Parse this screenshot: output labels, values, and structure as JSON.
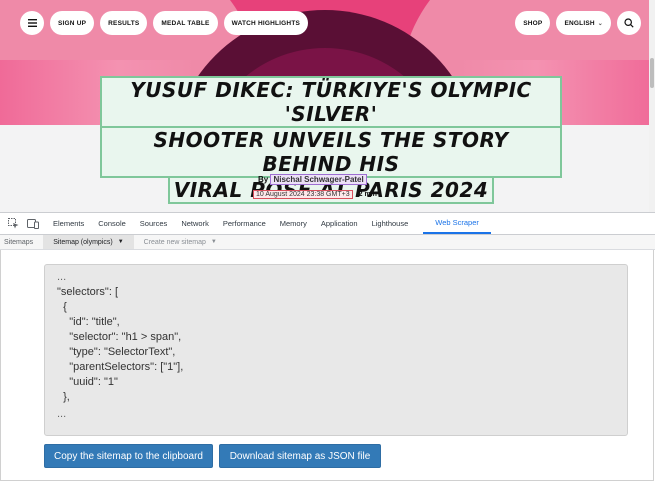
{
  "site": {
    "nav_left": [
      "SIGN UP",
      "RESULTS",
      "MEDAL TABLE",
      "WATCH HIGHLIGHTS"
    ],
    "nav_right_shop": "SHOP",
    "nav_right_lang": "ENGLISH",
    "headline_lines": [
      "YUSUF DIKEC: TÜRKIYE'S OLYMPIC 'SILVER'",
      "SHOOTER UNVEILS THE STORY BEHIND HIS",
      "VIRAL POSE AT PARIS 2024"
    ],
    "byline_prefix": "By",
    "author": "Nischal Schwager-Patel",
    "date": "10 August 2024 23:38 GMT+3",
    "read_time": "2 min"
  },
  "devtools": {
    "tabs": [
      "Elements",
      "Console",
      "Sources",
      "Network",
      "Performance",
      "Memory",
      "Application",
      "Lighthouse",
      "Web Scraper"
    ],
    "active_tab": "Web Scraper",
    "sub_tabs": {
      "sitemaps": "Sitemaps",
      "current": "Sitemap (olympics)",
      "create": "Create new sitemap"
    },
    "code_lines": [
      "...",
      "\"selectors\": [",
      "  {",
      "    \"id\": \"title\",",
      "    \"selector\": \"h1 > span\",",
      "    \"type\": \"SelectorText\",",
      "    \"parentSelectors\": [\"1\"],",
      "    \"uuid\": \"1\"",
      "  },",
      "..."
    ],
    "copy_button": "Copy the sitemap to the clipboard",
    "download_button": "Download sitemap as JSON file"
  },
  "colors": {
    "accent_blue": "#1a73e8",
    "button_blue": "#337ab7",
    "hero_pink": "#e7417a",
    "hero_dark": "#5a0f35",
    "headline_highlight": "#e9f6ee"
  }
}
